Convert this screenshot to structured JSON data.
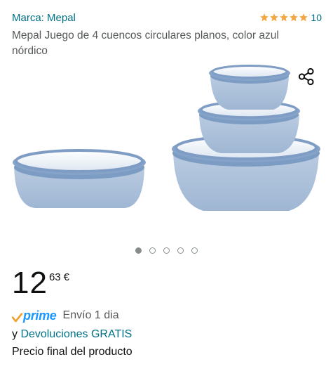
{
  "brand": {
    "label": "Marca: Mepal"
  },
  "rating": {
    "stars": 5,
    "count": "10",
    "star_color": "#f3a847"
  },
  "product": {
    "title": "Mepal Juego de 4 cuencos circulares planos, color azul nórdico"
  },
  "gallery": {
    "image_description_icon": "bowls-image",
    "total_images": 5,
    "active_index": 0
  },
  "price": {
    "whole": "12",
    "fraction": "63",
    "currency": "€"
  },
  "delivery": {
    "prime_label": "prime",
    "text": "Envío 1 dia"
  },
  "returns": {
    "prefix": "y ",
    "link": "Devoluciones GRATIS"
  },
  "final_price_note": "Precio final del producto",
  "colors": {
    "link": "#007185",
    "prime_blue": "#1a98ff",
    "prime_check": "#f0a12f",
    "text": "#0f1111",
    "muted": "#565959"
  }
}
